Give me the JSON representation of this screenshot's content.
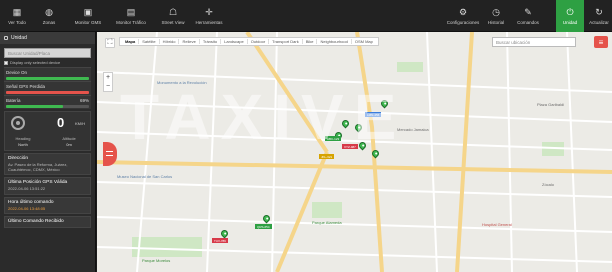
{
  "toolbar": {
    "left_buttons": [
      {
        "label": "Ver Todo",
        "icon": "grid-icon"
      },
      {
        "label": "Zonas",
        "icon": "globe-icon"
      },
      {
        "label": "Monitor GMS",
        "icon": "monitor-icon"
      },
      {
        "label": "Monitor Tráfico",
        "icon": "traffic-icon"
      },
      {
        "label": "Street View",
        "icon": "street-view-icon"
      },
      {
        "label": "Herramientas",
        "icon": "tools-icon"
      }
    ],
    "right_buttons": [
      {
        "label": "Configuraciones",
        "icon": "gears-icon",
        "active": false
      },
      {
        "label": "Historial",
        "icon": "clock-icon",
        "active": false
      },
      {
        "label": "Comandos",
        "icon": "wrench-icon",
        "active": false
      },
      {
        "label": "Unidad",
        "icon": "power-icon",
        "active": true
      },
      {
        "label": "Actualizar",
        "icon": "refresh-icon",
        "active": false
      }
    ]
  },
  "sidebar": {
    "header": "Unidad",
    "search_placeholder": "Buscar Unidad/Placa",
    "checkbox_label": "Display only selected device",
    "rows": [
      {
        "label": "Device On",
        "value": "",
        "bar": "green"
      },
      {
        "label": "Señal GPS Perdida",
        "value": "",
        "bar": "red"
      },
      {
        "label": "Batería",
        "value": "69%",
        "bar": "track",
        "level": 0.69
      }
    ],
    "gauge": {
      "speed": "0",
      "unit": "KM/H",
      "heading_label": "Heading",
      "heading_value": "North",
      "altitude_label": "Altitude",
      "altitude_value": "0m"
    },
    "info": [
      {
        "title": "Dirección",
        "value": "Av. Paseo de la Reforma, Juárez, Cuauhtémoc, CDMX, México",
        "orange": false
      },
      {
        "title": "Última Posición GPS Válida",
        "value": "2022-04-06 13:51:22",
        "orange": false
      },
      {
        "title": "Hora último comando",
        "value": "2022-04-06 13:48:05",
        "orange": true
      },
      {
        "title": "Último Comando Recibido",
        "value": "",
        "orange": false
      }
    ]
  },
  "map": {
    "tabs": [
      "Mapa",
      "Satélite",
      "Híbrido",
      "Relieve",
      "Tránsito",
      "Landscape",
      "Outdoor",
      "Transport Dark",
      "Bike",
      "Neighbourhood",
      "OSM Map"
    ],
    "search_placeholder": "Buscar ubicación",
    "labels": [
      {
        "text": "Monumento a la Revolución",
        "color": "blue"
      },
      {
        "text": "Parque Alameda",
        "color": "green"
      },
      {
        "text": "Museo Nacional de San Carlos",
        "color": "blue"
      },
      {
        "text": "Hospital General",
        "color": "red"
      },
      {
        "text": "Plaza Garibaldi",
        "color": "dark"
      },
      {
        "text": "Zócalo",
        "color": "dark"
      },
      {
        "text": "Parque Morelos",
        "color": "green"
      },
      {
        "text": "Mercado Jamaica",
        "color": "dark"
      }
    ],
    "vehicle_tags": [
      {
        "text": "ABC-123",
        "color": "green"
      },
      {
        "text": "XYZ-987",
        "color": "red"
      },
      {
        "text": "LMN-456",
        "color": "blue"
      },
      {
        "text": "JKL-321",
        "color": "yellow"
      },
      {
        "text": "QRS-654",
        "color": "green"
      },
      {
        "text": "TUV-789",
        "color": "red"
      }
    ]
  },
  "watermark": "TAXIVE"
}
